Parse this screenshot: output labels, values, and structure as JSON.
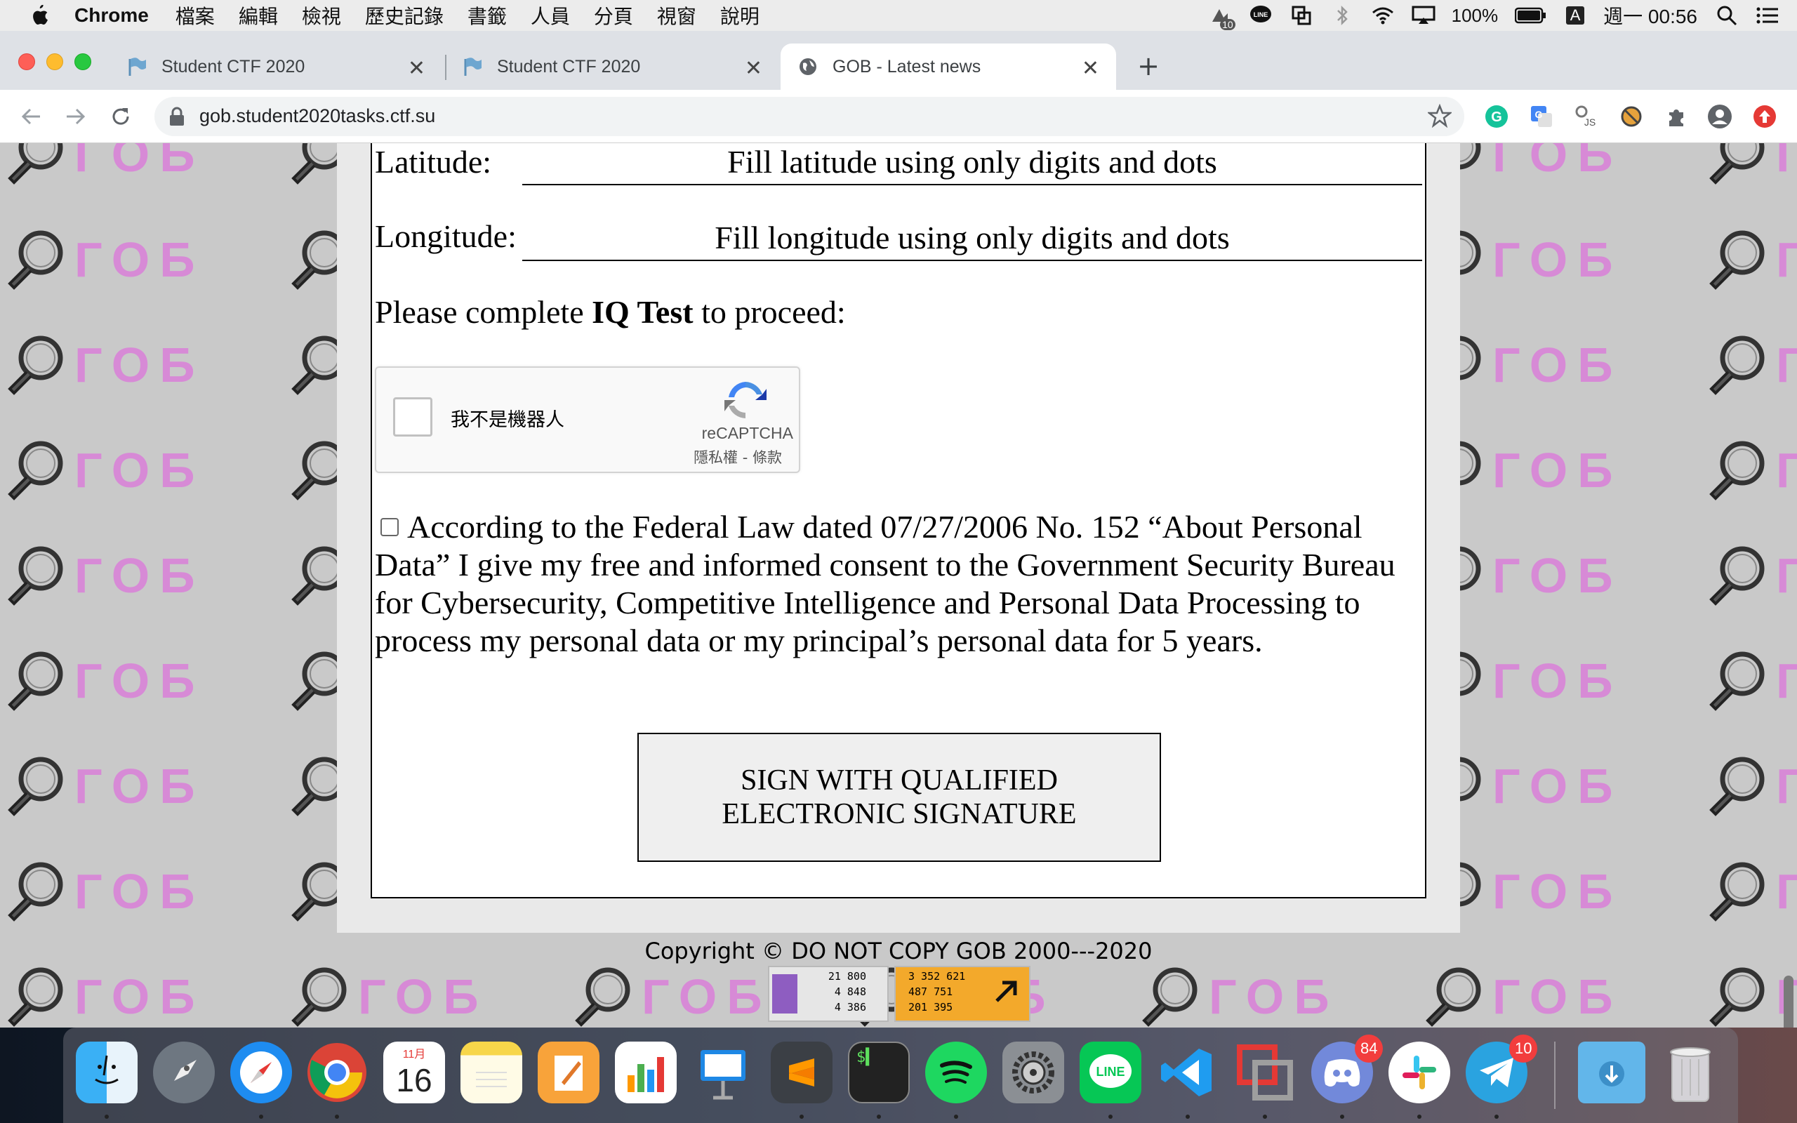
{
  "menubar": {
    "app_name": "Chrome",
    "items": [
      "檔案",
      "編輯",
      "檢視",
      "歷史記錄",
      "書籤",
      "人員",
      "分頁",
      "視窗",
      "說明"
    ],
    "battery": "100%",
    "input_method": "A",
    "clock": "週一 00:56",
    "notification_count": "10"
  },
  "tabs": [
    {
      "title": "Student CTF 2020",
      "icon": "flag-icon"
    },
    {
      "title": "Student CTF 2020",
      "icon": "flag-icon"
    },
    {
      "title": "GOB - Latest news",
      "icon": "globe-icon",
      "active": true
    }
  ],
  "address_bar": {
    "url": "gob.student2020tasks.ctf.su"
  },
  "page": {
    "watermark_text": "ГОБ",
    "latitude_label": "Latitude:",
    "latitude_placeholder": "Fill latitude using only digits and dots",
    "longitude_label": "Longitude:",
    "longitude_placeholder": "Fill longitude using only digits and dots",
    "iq_prompt_before": "Please complete ",
    "iq_prompt_bold": "IQ Test",
    "iq_prompt_after": " to proceed:",
    "captcha": {
      "label": "我不是機器人",
      "brand": "reCAPTCHA",
      "links": "隱私權 - 條款"
    },
    "consent_text": "According to the Federal Law dated 07/27/2006 No. 152 “About Personal Data” I give my free and informed consent to the Government Security Bureau for Cybersecurity, Competitive Intelligence and Personal Data Processing to process my personal data or my principal’s personal data for 5 years.",
    "sign_button_line1": "SIGN WITH QUALIFIED",
    "sign_button_line2": "ELECTRONIC SIGNATURE",
    "copyright": "Copyright © DO NOT COPY GOB 2000---2020",
    "counter1": {
      "l1": "21 800",
      "l2": "4 848",
      "l3": "4 386"
    },
    "counter2": {
      "l1": "3 352 621",
      "l2": "487 751",
      "l3": "201 395"
    }
  },
  "dock": {
    "calendar_month": "11月",
    "calendar_day": "16",
    "discord_badge": "84",
    "telegram_badge": "10",
    "apps": [
      "Finder",
      "Launchpad",
      "Safari",
      "Chrome",
      "Calendar",
      "Notes",
      "Pages",
      "Numbers",
      "Keynote",
      "Sublime Text",
      "Terminal",
      "Spotify",
      "System Preferences",
      "LINE",
      "VS Code",
      "Parallels",
      "Discord",
      "Slack",
      "Telegram",
      "Downloads",
      "Trash"
    ]
  },
  "colors": {
    "watermark": "#d78ad6",
    "page_bg": "#c9c9c9",
    "tabbar": "#dee1e6"
  }
}
